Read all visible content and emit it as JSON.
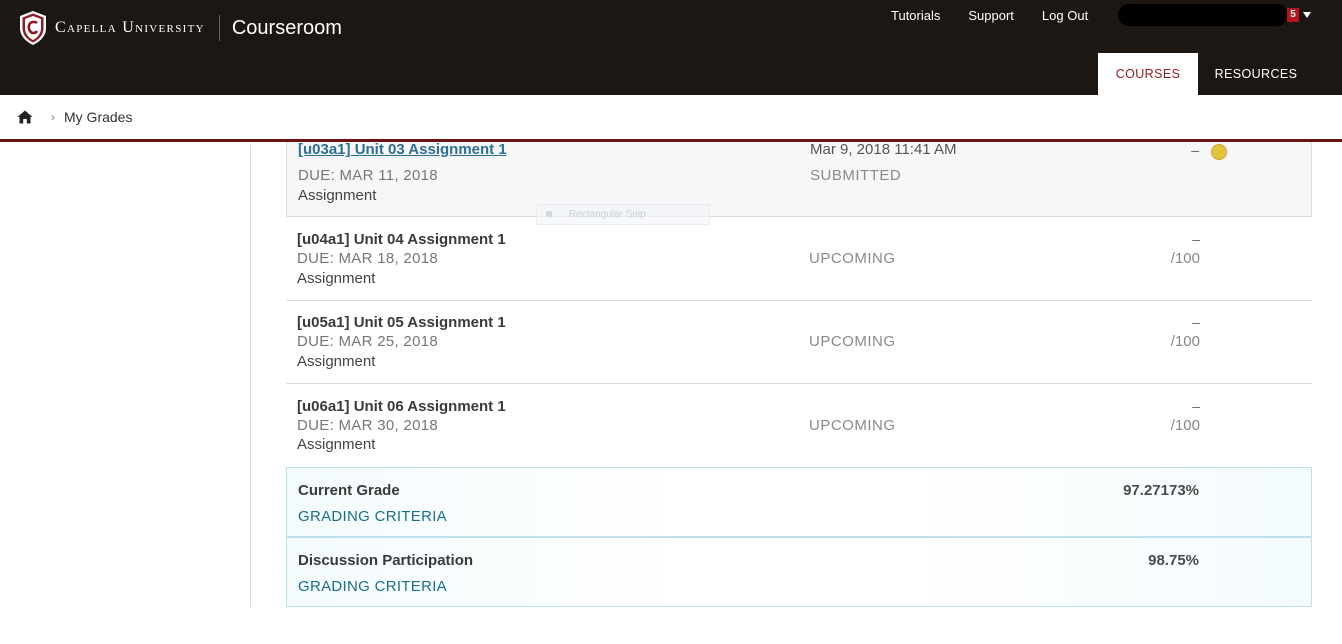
{
  "header": {
    "brand": "Capella University",
    "app_name": "Courseroom",
    "links": [
      "Tutorials",
      "Support",
      "Log Out"
    ],
    "notification_count": "5",
    "tabs": [
      "COURSES",
      "RESOURCES"
    ]
  },
  "breadcrumb": {
    "current": "My Grades"
  },
  "assignments": [
    {
      "title": "[u03a1] Unit 03 Assignment 1",
      "due": "DUE: MAR 11, 2018",
      "kind": "Assignment",
      "status_line1": "Mar 9, 2018 11:41 AM",
      "status": "SUBMITTED",
      "score_dash": "–"
    },
    {
      "title": "[u04a1] Unit 04 Assignment 1",
      "due": "DUE: MAR 18, 2018",
      "kind": "Assignment",
      "status": "UPCOMING",
      "score_dash": "–",
      "score_total": "/100"
    },
    {
      "title": "[u05a1] Unit 05 Assignment 1",
      "due": "DUE: MAR 25, 2018",
      "kind": "Assignment",
      "status": "UPCOMING",
      "score_dash": "–",
      "score_total": "/100"
    },
    {
      "title": "[u06a1] Unit 06 Assignment 1",
      "due": "DUE: MAR 30, 2018",
      "kind": "Assignment",
      "status": "UPCOMING",
      "score_dash": "–",
      "score_total": "/100"
    }
  ],
  "overlay": {
    "snip_label": "Rectangular Snip"
  },
  "grades": [
    {
      "title": "Current Grade",
      "criteria": "GRADING CRITERIA",
      "value": "97.27173%"
    },
    {
      "title": "Discussion Participation",
      "criteria": "GRADING CRITERIA",
      "value": "98.75%"
    }
  ],
  "colors": {
    "header_bg": "#1c1712",
    "accent": "#6e1117",
    "link": "#2a6f96",
    "criteria": "#1a6e88"
  }
}
